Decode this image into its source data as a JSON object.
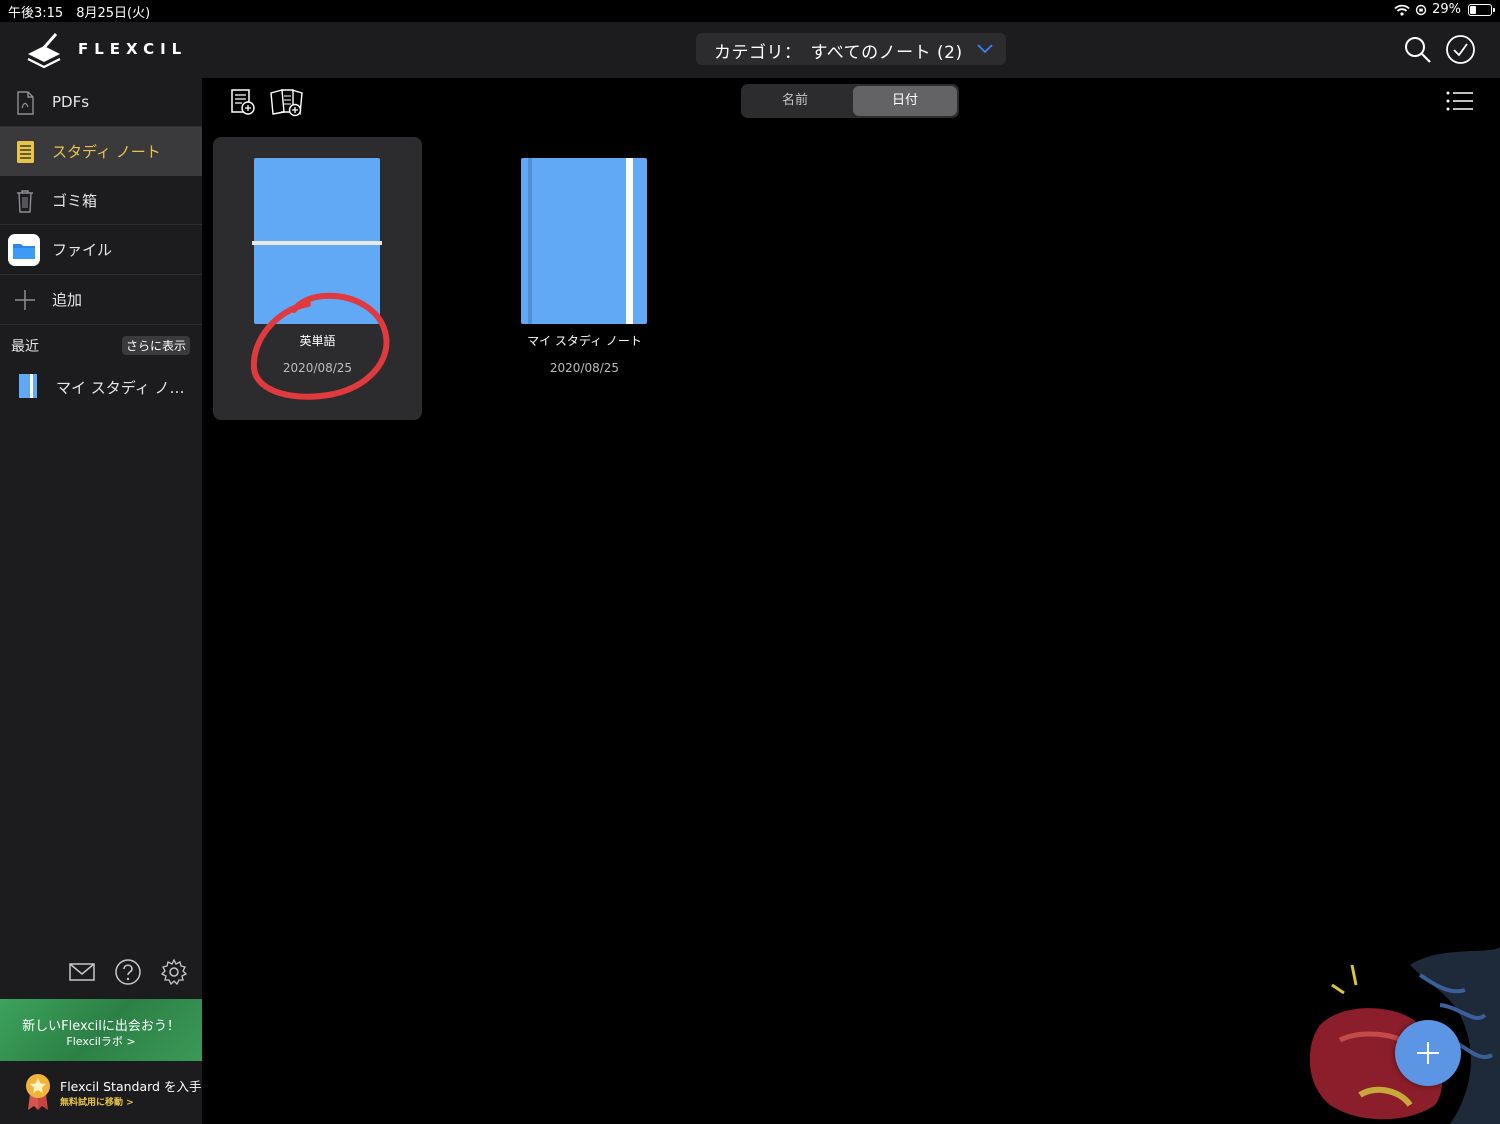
{
  "status_bar": {
    "time_date": "午後3:15　8月25日(火)",
    "battery": "29%"
  },
  "sidebar": {
    "brand": "FLEXCIL",
    "items": [
      {
        "label": "PDFs",
        "icon": "pdf-icon"
      },
      {
        "label": "スタディ ノート",
        "icon": "notebook-icon",
        "selected": true
      },
      {
        "label": "ゴミ箱",
        "icon": "trash-icon"
      },
      {
        "label": "ファイル",
        "icon": "files-folder-icon"
      },
      {
        "label": "追加",
        "icon": "plus-icon"
      }
    ],
    "recent": {
      "label": "最近",
      "more": "さらに表示",
      "items": [
        {
          "label": "マイ スタディ ノ…",
          "icon": "notebook-icon"
        }
      ]
    },
    "footer_icons": [
      "mail-icon",
      "help-icon",
      "gear-icon"
    ],
    "promo": {
      "title": "新しいFlexcilに出会おう！",
      "subtitle": "Flexcilラボ >"
    },
    "standard": {
      "title": "Flexcil Standard を入手",
      "subtitle": "無料試用に移動 >"
    }
  },
  "header": {
    "category_label": "カテゴリ：　すべてのノート (2)",
    "icons": [
      "search-icon",
      "check-circle-icon"
    ]
  },
  "toolbar": {
    "icons": [
      "new-note-icon",
      "new-note-from-template-icon",
      "list-view-icon"
    ],
    "sort": {
      "options": [
        "名前",
        "日付"
      ],
      "selected": "日付"
    }
  },
  "notes": [
    {
      "title": "英単語",
      "date": "2020/08/25",
      "selected": true
    },
    {
      "title": "マイ スタディ ノート",
      "date": "2020/08/25",
      "selected": false
    }
  ],
  "colors": {
    "accent_yellow": "#e9c44a",
    "cover_blue": "#62a9f5",
    "annotation_red": "#e03a3e",
    "fab_blue": "#5b95e3"
  }
}
